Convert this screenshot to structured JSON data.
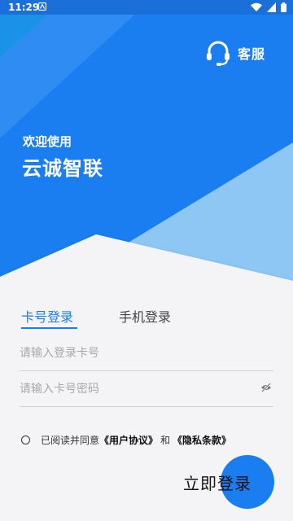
{
  "status_bar": {
    "time": "11:29"
  },
  "header": {
    "service_label": "客服",
    "welcome": "欢迎使用",
    "app_name": "云诚智联"
  },
  "tabs": [
    {
      "label": "卡号登录",
      "active": true
    },
    {
      "label": "手机登录",
      "active": false
    }
  ],
  "form": {
    "card_placeholder": "请输入登录卡号",
    "password_placeholder": "请输入卡号密码"
  },
  "agreement": {
    "prefix": "已阅读并同意",
    "user_agreement": "《用户协议》",
    "conjunction": "和",
    "privacy_policy": "《隐私条款》",
    "checked": false
  },
  "login_button": {
    "label": "立即登录"
  },
  "colors": {
    "primary": "#1a7ef0",
    "status_bar": "#1a6fd9",
    "background": "#f4f4f6"
  }
}
